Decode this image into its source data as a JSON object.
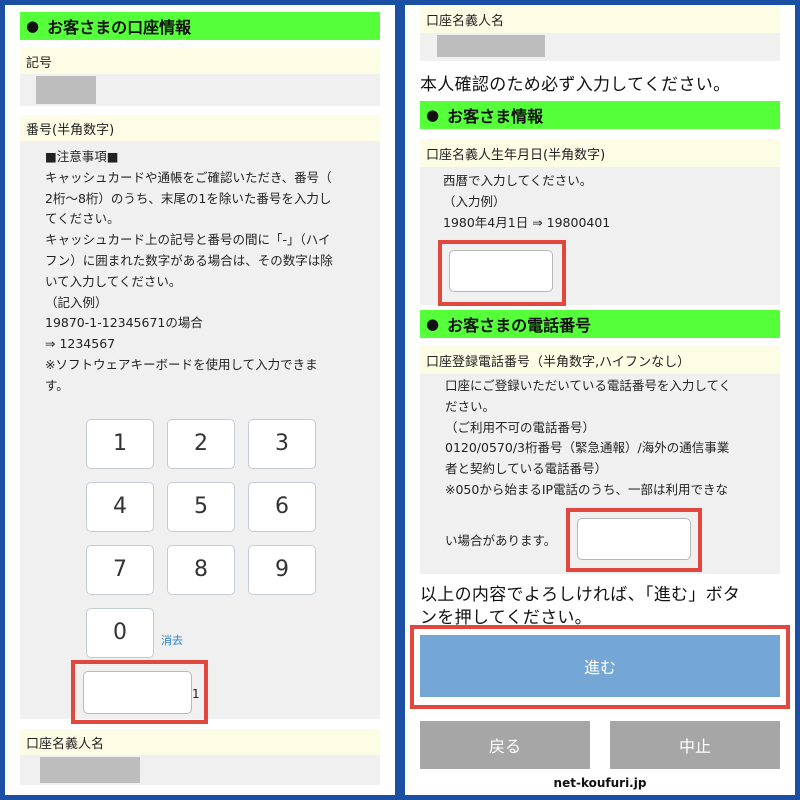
{
  "left": {
    "account_header": "お客さまの口座情報",
    "symbol_label": "記号",
    "number_label": "番号(半角数字)",
    "notes": [
      "■注意事項■",
      "キャッシュカードや通帳をご確認いただき、番号（",
      "2桁〜8桁）のうち、末尾の1を除いた番号を入力し",
      "てください。",
      "キャッシュカード上の記号と番号の間に「-」（ハイ",
      "フン）に囲まれた数字がある場合は、その数字は除",
      "いて入力してください。",
      "（記入例）",
      "19870-1-12345671の場合",
      "⇒ 1234567",
      "※ソフトウェアキーボードを使用して入力できま",
      "す。"
    ],
    "keypad": [
      "1",
      "2",
      "3",
      "4",
      "5",
      "6",
      "7",
      "8",
      "9",
      "0"
    ],
    "clear_label": "消去",
    "suffix_digit": "1",
    "holder_label": "口座名義人名"
  },
  "right": {
    "holder_label": "口座名義人名",
    "confirm_text": "本人確認のため必ず入力してください。",
    "customer_header": "お客さま情報",
    "birth_label": "口座名義人生年月日(半角数字)",
    "birth_notes": [
      "西暦で入力してください。",
      "（入力例）",
      "1980年4月1日 ⇒ 19800401"
    ],
    "phone_header": "お客さまの電話番号",
    "phone_label": "口座登録電話番号（半角数字,ハイフンなし）",
    "phone_notes": [
      "口座にご登録いただいている電話番号を入力してく",
      "ださい。",
      "（ご利用不可の電話番号）",
      "0120/0570/3桁番号（緊急通報）/海外の通信事業",
      "者と契約している電話番号）",
      "※050から始まるIP電話のうち、一部は利用できな"
    ],
    "phone_notes_last": "い場合があります。",
    "proceed_text_1": "以上の内容でよろしければ、「進む」ボタ",
    "proceed_text_2": "ンを押してください。",
    "proceed_button": "進む",
    "back_button": "戻る",
    "cancel_button": "中止",
    "site_tag": "net-koufuri.jp"
  },
  "colors": {
    "header_green": "#55ff3a",
    "label_yellow": "#fdfde6",
    "highlight_red": "#e0473d",
    "proceed_blue": "#74a6d6",
    "button_grey": "#a6a6a6",
    "frame_blue": "#1a4fa3"
  }
}
